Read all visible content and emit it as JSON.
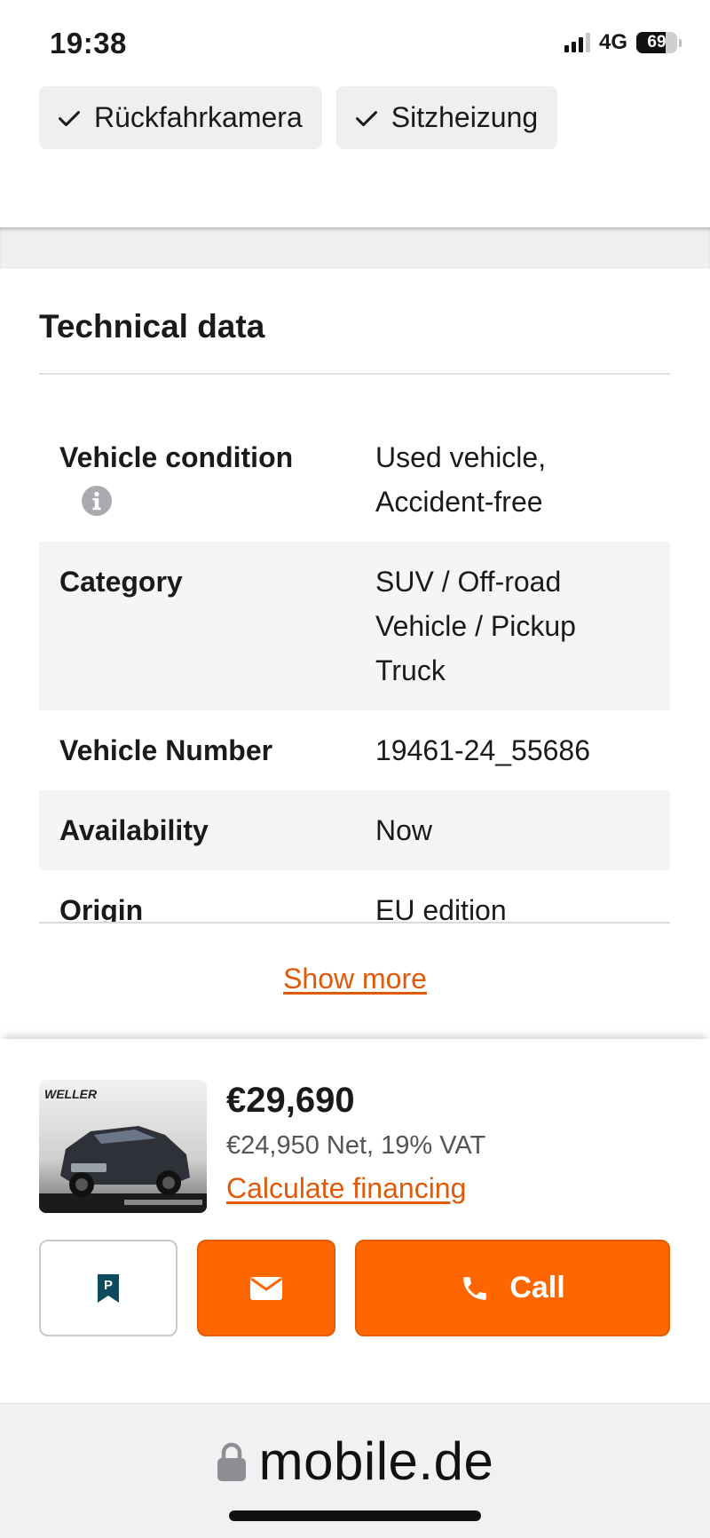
{
  "status_bar": {
    "time": "19:38",
    "network": "4G",
    "battery": "69",
    "battery_level": 0.69
  },
  "features": [
    {
      "label": "Rückfahrkamera",
      "icon": "check-icon"
    },
    {
      "label": "Sitzheizung",
      "icon": "check-icon"
    }
  ],
  "technical": {
    "title": "Technical data",
    "rows": [
      {
        "label": "Vehicle condition",
        "value": "Used vehicle, Accident-free",
        "info_icon": "info-icon"
      },
      {
        "label": "Category",
        "value": "SUV / Off-road Vehicle / Pickup Truck"
      },
      {
        "label": "Vehicle Number",
        "value": "19461-24_55686"
      },
      {
        "label": "Availability",
        "value": "Now"
      },
      {
        "label": "Origin",
        "value": "EU edition"
      }
    ],
    "show_more": "Show more"
  },
  "listing": {
    "thumbnail_brand": "WELLER",
    "price": "€29,690",
    "price_net": "€24,950 Net, 19% VAT",
    "financing_link": "Calculate financing",
    "park_icon": "bookmark-p-icon",
    "mail_icon": "envelope-icon",
    "call_icon": "phone-icon",
    "call_label": "Call"
  },
  "colors": {
    "accent": "#ff6600",
    "link": "#e05a0a",
    "park_icon": "#0d4a5c"
  },
  "browser": {
    "url": "mobile.de",
    "lock_icon": "lock-icon"
  }
}
